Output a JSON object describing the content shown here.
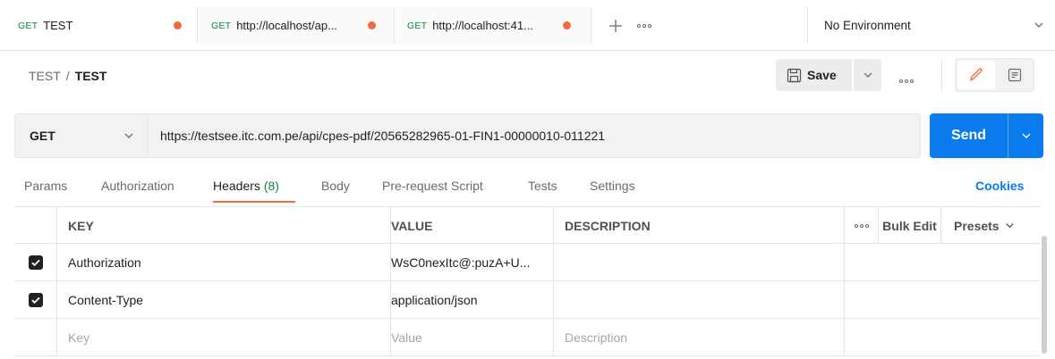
{
  "tabs": [
    {
      "method": "GET",
      "name": "TEST"
    },
    {
      "method": "GET",
      "name": "http://localhost/ap..."
    },
    {
      "method": "GET",
      "name": "http://localhost:41..."
    }
  ],
  "environment": "No Environment",
  "breadcrumb": {
    "collection": "TEST",
    "separator": "/",
    "request": "TEST"
  },
  "save_label": "Save",
  "request": {
    "method": "GET",
    "url": "https://testsee.itc.com.pe/api/cpes-pdf/20565282965-01-FIN1-00000010-011221",
    "send_label": "Send"
  },
  "request_tabs": [
    {
      "label": "Params"
    },
    {
      "label": "Authorization"
    },
    {
      "label": "Headers",
      "count": "(8)"
    },
    {
      "label": "Body"
    },
    {
      "label": "Pre-request Script"
    },
    {
      "label": "Tests"
    },
    {
      "label": "Settings"
    }
  ],
  "cookies_label": "Cookies",
  "headers_table": {
    "columns": {
      "key": "KEY",
      "value": "VALUE",
      "description": "DESCRIPTION",
      "bulk_edit": "Bulk Edit",
      "presets": "Presets"
    },
    "rows": [
      {
        "checked": true,
        "key": "Authorization",
        "value": "WsC0nexItc@:puzA+U...",
        "description": ""
      },
      {
        "checked": true,
        "key": "Content-Type",
        "value": "application/json",
        "description": ""
      }
    ],
    "placeholders": {
      "key": "Key",
      "value": "Value",
      "description": "Description"
    }
  },
  "colors": {
    "accent": "#097bed",
    "dirty_dot": "#f26b3a",
    "method_green": "#0b8a3e"
  },
  "icons": [
    "plus-icon",
    "ellipsis-icon",
    "chevron-down-icon",
    "save-icon",
    "pencil-icon",
    "document-icon",
    "checkbox-icon"
  ]
}
